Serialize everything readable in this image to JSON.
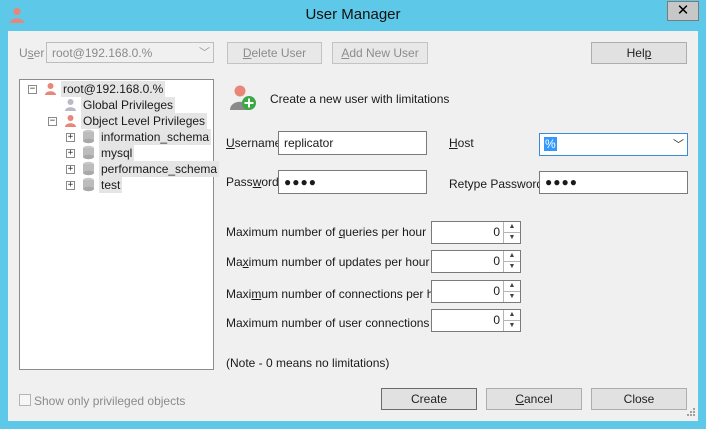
{
  "window": {
    "title": "User Manager",
    "close": "✕",
    "accent": "#5ec8e8"
  },
  "top": {
    "user_label_prefix": "U",
    "user_label_mn": "s",
    "user_label_rest": "er",
    "user_value": "root@192.168.0.%",
    "delete_user": {
      "pre": "",
      "mn": "D",
      "rest": "elete User"
    },
    "add_new_user": {
      "pre": "",
      "mn": "A",
      "rest": "dd New User"
    },
    "help": {
      "pre": "Hel",
      "mn": "p",
      "rest": ""
    }
  },
  "tree": {
    "root": "root@192.168.0.%",
    "global": "Global Privileges",
    "object": "Object Level Privileges",
    "dbs": [
      "information_schema",
      "mysql",
      "performance_schema",
      "test"
    ]
  },
  "header": {
    "text": "Create a new user with limitations"
  },
  "form": {
    "username": {
      "pre": "",
      "mn": "U",
      "rest": "sername",
      "value": "replicator"
    },
    "host": {
      "pre": "",
      "mn": "H",
      "rest": "ost",
      "value": "%"
    },
    "password": {
      "pre": "Pass",
      "mn": "w",
      "rest": "ord",
      "mask": "●●●●"
    },
    "retype": {
      "label": "Retype Password",
      "mask": "●●●●"
    }
  },
  "limits": [
    {
      "pre": "Maximum number of ",
      "mn": "q",
      "rest": "ueries per hour",
      "value": "0"
    },
    {
      "pre": "Ma",
      "mn": "x",
      "rest": "imum number of updates per hour",
      "value": "0"
    },
    {
      "pre": "Maxi",
      "mn": "m",
      "rest": "um number of connections per hour",
      "value": "0"
    },
    {
      "pre": "Maximum number of user connections",
      "mn": "",
      "rest": "",
      "value": "0"
    }
  ],
  "note": "(Note - 0 means no limitations)",
  "footer": {
    "show_only": "Show only privileged objects",
    "create": {
      "pre": "Create",
      "mn": "",
      "rest": ""
    },
    "cancel": {
      "pre": "",
      "mn": "C",
      "rest": "ancel"
    },
    "close": {
      "pre": "Close",
      "mn": "",
      "rest": ""
    }
  }
}
